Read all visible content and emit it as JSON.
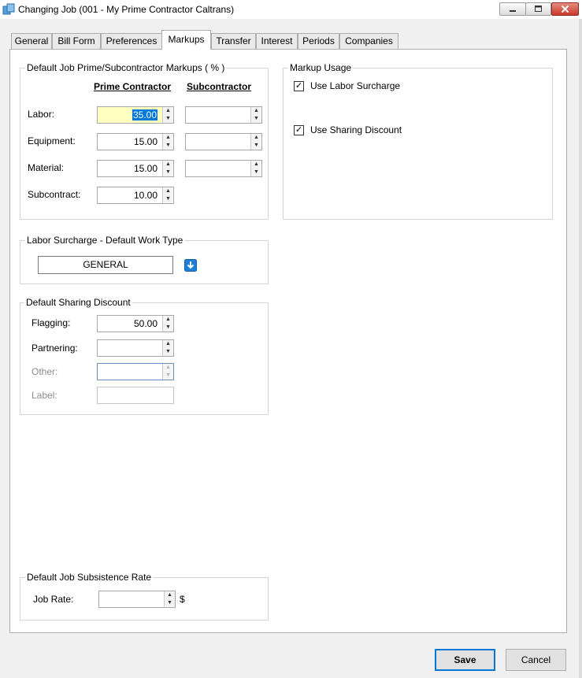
{
  "window": {
    "title": "Changing Job  (001 - My Prime Contractor Caltrans)"
  },
  "tabs": [
    "General",
    "Bill Form",
    "Preferences",
    "Markups",
    "Transfer",
    "Interest",
    "Periods",
    "Companies"
  ],
  "active_tab": "Markups",
  "markups": {
    "legend": "Default Job Prime/Subcontractor Markups ( % )",
    "col_prime": "Prime Contractor",
    "col_sub": "Subcontractor",
    "rows": [
      {
        "label": "Labor:",
        "prime": "35.00",
        "sub": ""
      },
      {
        "label": "Equipment:",
        "prime": "15.00",
        "sub": ""
      },
      {
        "label": "Material:",
        "prime": "15.00",
        "sub": ""
      },
      {
        "label": "Subcontract:",
        "prime": "10.00"
      }
    ]
  },
  "usage": {
    "legend": "Markup Usage",
    "labor_surcharge": {
      "label": "Use Labor Surcharge",
      "checked": true
    },
    "sharing_discount": {
      "label": "Use Sharing Discount",
      "checked": true
    }
  },
  "labor_surcharge": {
    "legend": "Labor Surcharge - Default Work Type",
    "value": "GENERAL",
    "icon": "arrow-down-icon"
  },
  "sharing": {
    "legend": "Default Sharing Discount",
    "flagging": {
      "label": "Flagging:",
      "value": "50.00"
    },
    "partnering": {
      "label": "Partnering:",
      "value": ""
    },
    "other": {
      "label": "Other:",
      "value": ""
    },
    "label_field": {
      "label": "Label:",
      "value": ""
    }
  },
  "subsistence": {
    "legend": "Default Job Subsistence Rate",
    "rate_label": "Job Rate:",
    "rate_value": "",
    "unit": "$"
  },
  "buttons": {
    "save": "Save",
    "cancel": "Cancel"
  },
  "colors": {
    "highlight": "#ffffc0",
    "selection": "#0078d7",
    "info_icon": "#1e7fd8"
  }
}
